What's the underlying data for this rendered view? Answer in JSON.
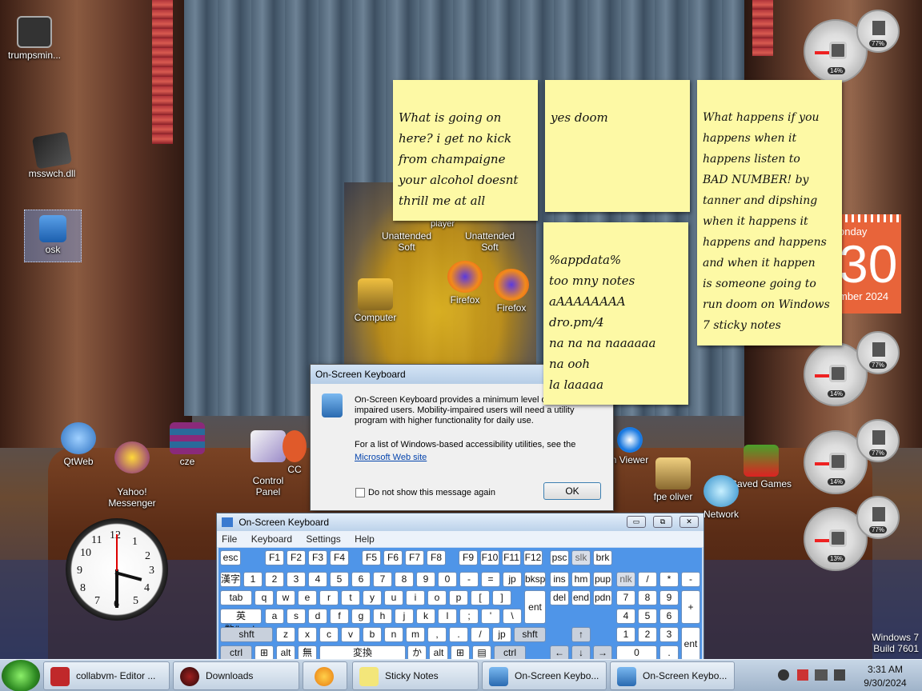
{
  "desktop_icons": [
    {
      "label": "trumpsmin...",
      "icon": "window-thumbnail-icon"
    },
    {
      "label": "msswch.dll",
      "icon": "dll-file-icon"
    },
    {
      "label": "osk",
      "icon": "keyboard-app-icon"
    },
    {
      "label": "QtWeb",
      "icon": "qt-icon"
    },
    {
      "label": "Yahoo!\nMessenger",
      "icon": "yahoo-icon"
    },
    {
      "label": "cze",
      "icon": "winrar-icon"
    },
    {
      "label": "Control\nPanel",
      "icon": "control-panel-icon"
    },
    {
      "label": "CC",
      "icon": "cc-icon"
    },
    {
      "label": "Computer",
      "icon": "computer-icon"
    },
    {
      "label": "Unattended\nSoft",
      "icon": "unattended-soft-icon"
    },
    {
      "label": "Unattended\nSoft",
      "icon": "unattended-soft-icon"
    },
    {
      "label": "player",
      "icon": "player-icon"
    },
    {
      "label": "Firefox",
      "icon": "firefox-icon"
    },
    {
      "label": "Firefox",
      "icon": "firefox-icon"
    },
    {
      "label": "n Viewer",
      "icon": "teamviewer-icon"
    },
    {
      "label": "fpe oliver",
      "icon": "folder-icon"
    },
    {
      "label": "Saved Games",
      "icon": "saved-games-icon"
    },
    {
      "label": "Network",
      "icon": "network-icon"
    }
  ],
  "sticky_notes": [
    {
      "lines": [
        "What is going on",
        "here? i get no kick",
        "from champaigne",
        "your alcohol doesnt",
        "thrill me at all"
      ]
    },
    {
      "lines": [
        "yes doom"
      ]
    },
    {
      "lines": [
        "What happens if you",
        "happens when it",
        "happens listen to",
        "BAD NUMBER! by",
        "tanner and dipshing",
        "when it happens it",
        "happens and happens",
        "and when it happen",
        "is someone going to",
        "run doom on Windows",
        "7 sticky notes"
      ]
    },
    {
      "lines": [
        "%appdata%",
        "too mny notes",
        "aAAAAAAAA",
        "dro.pm/4",
        "na na na naaaaaa",
        "na ooh",
        "la laaaaa"
      ]
    }
  ],
  "gadgets": {
    "cpu_percents": [
      "14%",
      "14%",
      "14%",
      "13%"
    ],
    "mem_percents": [
      "77%",
      "77%",
      "77%",
      "77%"
    ],
    "calendar": {
      "day": "onday",
      "date": "30",
      "month": "mber 2024"
    },
    "clock_numbers": [
      "12",
      "1",
      "2",
      "3",
      "4",
      "5",
      "6",
      "7",
      "8",
      "9",
      "10",
      "11"
    ]
  },
  "osk_dialog": {
    "title": "On-Screen Keyboard",
    "message": "On-Screen Keyboard provides a minimum level of f mobility-impaired users. Mobility-impaired users will need a utility program with higher functionality for daily use.",
    "list_text": "For a list of Windows-based accessibility utilities, see the",
    "link": "Microsoft Web site",
    "checkbox_label": "Do not show this message again",
    "ok": "OK"
  },
  "osk_window": {
    "title": "On-Screen Keyboard",
    "menu": [
      "File",
      "Keyboard",
      "Settings",
      "Help"
    ],
    "controls": {
      "min": "▭",
      "max": "⧉",
      "close": "✕"
    }
  },
  "keys": {
    "row1": [
      "esc",
      "F1",
      "F2",
      "F3",
      "F4",
      "F5",
      "F6",
      "F7",
      "F8",
      "F9",
      "F10",
      "F11",
      "F12",
      "psc",
      "slk",
      "brk"
    ],
    "row2": [
      "漢字",
      "1",
      "2",
      "3",
      "4",
      "5",
      "6",
      "7",
      "8",
      "9",
      "0",
      "-",
      "=",
      "jp",
      "bksp",
      "ins",
      "hm",
      "pup",
      "nlk",
      "/",
      "*",
      "-"
    ],
    "row3": [
      "tab",
      "q",
      "w",
      "e",
      "r",
      "t",
      "y",
      "u",
      "i",
      "o",
      "p",
      "[",
      "]",
      "ent",
      "del",
      "end",
      "pdn",
      "7",
      "8",
      "9",
      "+"
    ],
    "row4": [
      "英数/Lock",
      "a",
      "s",
      "d",
      "f",
      "g",
      "h",
      "j",
      "k",
      "l",
      ";",
      "'",
      "\\",
      "4",
      "5",
      "6"
    ],
    "row5": [
      "shft",
      "z",
      "x",
      "c",
      "v",
      "b",
      "n",
      "m",
      ",",
      ".",
      "/",
      "jp",
      "shft",
      "↑",
      "1",
      "2",
      "3",
      "ent"
    ],
    "row6": [
      "ctrl",
      "⊞",
      "alt",
      "無",
      "変換",
      "かな",
      "alt",
      "⊞",
      "▤",
      "ctrl",
      "←",
      "↓",
      "→",
      "0",
      "."
    ]
  },
  "taskbar": {
    "buttons": [
      "collabvm- Editor ...",
      "Downloads",
      "",
      "Sticky Notes",
      "On-Screen Keybo...",
      "On-Screen Keybo..."
    ],
    "time": "3:31 AM",
    "date": "9/30/2024"
  },
  "watermark": {
    "line1": "Windows 7",
    "line2": "Build 7601"
  }
}
